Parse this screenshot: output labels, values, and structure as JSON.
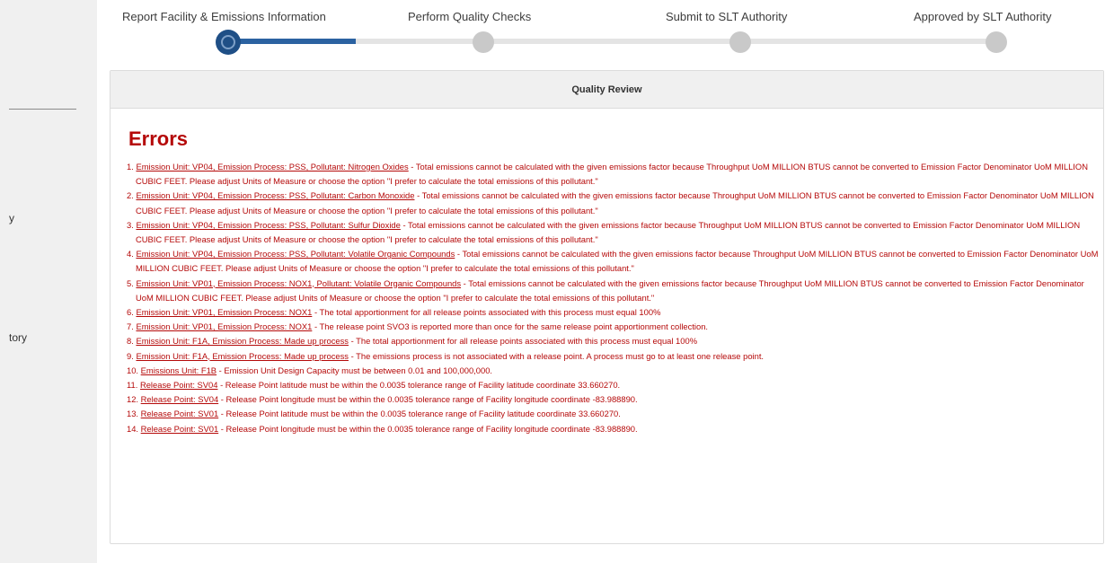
{
  "sidebar": {
    "fragments": [
      "y",
      "tory"
    ]
  },
  "stepper": {
    "steps": [
      {
        "label": "Report Facility & Emissions Information",
        "status": "active"
      },
      {
        "label": "Perform Quality Checks",
        "status": "pending"
      },
      {
        "label": "Submit to SLT Authority",
        "status": "pending"
      },
      {
        "label": "Approved by SLT Authority",
        "status": "pending"
      }
    ]
  },
  "card": {
    "title": "Quality Review",
    "errors_heading": "Errors",
    "errors": [
      {
        "num": "1.",
        "link": "Emission Unit: VP04, Emission Process: PSS, Pollutant: Nitrogen Oxides",
        "text": " - Total emissions cannot be calculated with the given emissions factor because Throughput UoM MILLION BTUS cannot be converted to Emission Factor Denominator UoM MILLION CUBIC FEET. Please adjust Units of Measure or choose the option \"I prefer to calculate the total emissions of this pollutant.\""
      },
      {
        "num": "2.",
        "link": "Emission Unit: VP04, Emission Process: PSS, Pollutant: Carbon Monoxide",
        "text": " - Total emissions cannot be calculated with the given emissions factor because Throughput UoM MILLION BTUS cannot be converted to Emission Factor Denominator UoM MILLION CUBIC FEET. Please adjust Units of Measure or choose the option \"I prefer to calculate the total emissions of this pollutant.\""
      },
      {
        "num": "3.",
        "link": "Emission Unit: VP04, Emission Process: PSS, Pollutant: Sulfur Dioxide",
        "text": " - Total emissions cannot be calculated with the given emissions factor because Throughput UoM MILLION BTUS cannot be converted to Emission Factor Denominator UoM MILLION CUBIC FEET. Please adjust Units of Measure or choose the option \"I prefer to calculate the total emissions of this pollutant.\""
      },
      {
        "num": "4.",
        "link": "Emission Unit: VP04, Emission Process: PSS, Pollutant: Volatile Organic Compounds",
        "text": " - Total emissions cannot be calculated with the given emissions factor because Throughput UoM MILLION BTUS cannot be converted to Emission Factor Denominator UoM MILLION CUBIC FEET. Please adjust Units of Measure or choose the option \"I prefer to calculate the total emissions of this pollutant.\""
      },
      {
        "num": "5.",
        "link": "Emission Unit: VP01, Emission Process: NOX1, Pollutant: Volatile Organic Compounds",
        "text": " - Total emissions cannot be calculated with the given emissions factor because Throughput UoM MILLION BTUS cannot be converted to Emission Factor Denominator UoM MILLION CUBIC FEET. Please adjust Units of Measure or choose the option \"I prefer to calculate the total emissions of this pollutant.\""
      },
      {
        "num": "6.",
        "link": "Emission Unit: VP01, Emission Process: NOX1",
        "text": " - The total apportionment for all release points associated with this process must equal 100%"
      },
      {
        "num": "7.",
        "link": "Emission Unit: VP01, Emission Process: NOX1",
        "text": " - The release point SVO3 is reported more than once for the same release point apportionment collection."
      },
      {
        "num": "8.",
        "link": "Emission Unit: F1A, Emission Process: Made up process",
        "text": " - The total apportionment for all release points associated with this process must equal 100%"
      },
      {
        "num": "9.",
        "link": "Emission Unit: F1A, Emission Process: Made up process",
        "text": " - The emissions process is not associated with a release point. A process must go to at least one release point."
      },
      {
        "num": "10.",
        "link": "Emissions Unit: F1B",
        "text": " - Emission Unit Design Capacity must be between 0.01 and 100,000,000."
      },
      {
        "num": "11.",
        "link": "Release Point: SV04",
        "text": " - Release Point latitude must be within the 0.0035 tolerance range of Facility latitude coordinate 33.660270."
      },
      {
        "num": "12.",
        "link": "Release Point: SV04",
        "text": " - Release Point longitude must be within the 0.0035 tolerance range of Facility longitude coordinate -83.988890."
      },
      {
        "num": "13.",
        "link": "Release Point: SV01",
        "text": " - Release Point latitude must be within the 0.0035 tolerance range of Facility latitude coordinate 33.660270."
      },
      {
        "num": "14.",
        "link": "Release Point: SV01",
        "text": " - Release Point longitude must be within the 0.0035 tolerance range of Facility longitude coordinate -83.988890."
      }
    ]
  },
  "colors": {
    "error": "#b50909",
    "stepper_active": "#1f4f86",
    "stepper_inactive": "#c9c9c9"
  }
}
